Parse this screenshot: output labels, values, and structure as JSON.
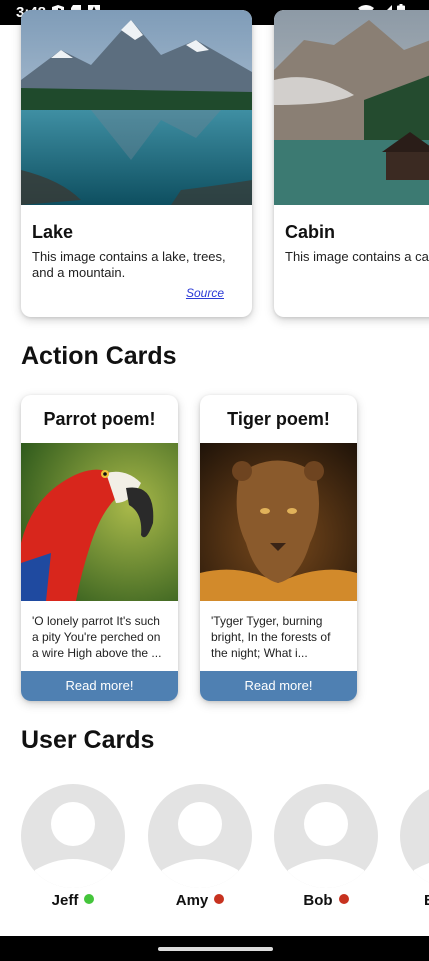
{
  "status_bar": {
    "time": "3:48",
    "left_icons": [
      "shield-icon",
      "sd-card-icon",
      "text-app-icon"
    ],
    "right_icons": [
      "wifi-icon",
      "signal-icon",
      "battery-icon"
    ]
  },
  "image_cards": [
    {
      "title": "Lake",
      "description": "This image contains a lake, trees, and a mountain.",
      "source_label": "Source"
    },
    {
      "title": "Cabin",
      "description": "This image contains a cab"
    }
  ],
  "sections": {
    "action_cards": "Action Cards",
    "user_cards": "User Cards"
  },
  "action_cards": [
    {
      "title": "Parrot poem!",
      "text": "'O lonely parrot It's such a pity You're perched on a wire High above the ...",
      "button": "Read more!"
    },
    {
      "title": "Tiger poem!",
      "text": "'Tyger Tyger, burning bright, In the forests of the night; What i...",
      "button": "Read more!"
    }
  ],
  "users": [
    {
      "name": "Jeff",
      "status": "online",
      "status_color": "#44c53b"
    },
    {
      "name": "Amy",
      "status": "offline",
      "status_color": "#c7321f"
    },
    {
      "name": "Bob",
      "status": "offline",
      "status_color": "#c7321f"
    },
    {
      "name": "B",
      "status": "unknown",
      "status_color": "#c7321f"
    }
  ],
  "colors": {
    "button_bg": "#4f80b2",
    "link": "#2a39d6",
    "avatar_bg": "#e3e3e3"
  }
}
